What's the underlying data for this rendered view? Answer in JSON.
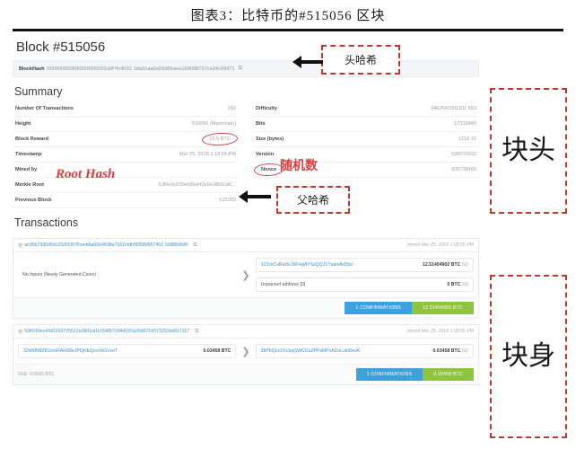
{
  "figure": {
    "title": "图表3：比特币的#515056 区块"
  },
  "explorer": {
    "block_title": "Block #515056",
    "hash_bar": {
      "label": "BlockHash",
      "value": "000000000000000000001a9f7fc4032 1da51aa0a55d65aea199008737ce24c99471",
      "copy_icon": "⧉"
    },
    "summary_heading": "Summary",
    "summary_left": [
      {
        "key": "Number Of Transactions",
        "value": "182",
        "circled": false
      },
      {
        "key": "Height",
        "value": "515056 (Mainchain)",
        "circled": false
      },
      {
        "key": "Block Reward",
        "value": "12.5 BTC",
        "circled": true
      },
      {
        "key": "Timestamp",
        "value": "Mar 25, 2018 1:18:55 PM",
        "circled": false
      },
      {
        "key": "Mined by",
        "value": "",
        "circled": false
      },
      {
        "key": "Merkle Root",
        "value": "9.80e9c530ed2bd43a5e38b6cd0...",
        "circled": false
      },
      {
        "key": "Previous Block",
        "value": "515055",
        "circled": false
      }
    ],
    "summary_right": [
      {
        "key": "Difficulty",
        "value": "3462542391191.563",
        "circled": false
      },
      {
        "key": "Bits",
        "value": "17315849",
        "circled": false
      },
      {
        "key": "Size (bytes)",
        "value": "1218 31",
        "circled": false
      },
      {
        "key": "Version",
        "value": "536070912",
        "circled": false
      },
      {
        "key": "Nonce",
        "value": "926728450",
        "circled": true
      }
    ],
    "transactions_heading": "Transactions",
    "transactions": [
      {
        "hash": "acd5b7336959c250f3367fceeb6a62e4538e7162cfdb5f3580657453 10d8696d0",
        "gear_icon": "⚙",
        "copy_icon": "⧉",
        "time": "mined Mar 25, 2018 1:18:55 PM",
        "inputs": [
          {
            "address": "No Inputs (Newly Generated Coins)",
            "amount": "",
            "unit": "",
            "boxed": false,
            "muted": true
          }
        ],
        "arrow_icon": "❯",
        "outputs": [
          {
            "address": "1C1mCsRuklx1KFegAYSzQQJV7samAd2pv",
            "amount": "12.51404902 BTC",
            "unit": "(U)",
            "boxed": true,
            "muted": false
          },
          {
            "address": "Unparsed address [0]",
            "amount": "0 BTC",
            "unit": "(U)",
            "boxed": true,
            "muted": true
          }
        ],
        "fee": "",
        "badge_confirmations": "1 CONFIRMATIONS",
        "badge_amount": "12.51404902 BTC"
      },
      {
        "hash": "53b019ec43d3193725512a3901a01c590671944197a25d6714373251bd817117",
        "gear_icon": "⚙",
        "copy_icon": "⧉",
        "time": "mined Mar 25, 2018 1:18:55 PM",
        "inputs": [
          {
            "address": "32H6BWZE1mxRAH38eJPQHbZycnYiGVveT",
            "amount": "0.03458 BTC",
            "unit": "",
            "boxed": true,
            "muted": false
          }
        ],
        "arrow_icon": "❯",
        "outputs": [
          {
            "address": "38PbQcsXXcbqQWCUuZPFkMPvADxLukiDevK",
            "amount": "0.03458 BTC",
            "unit": "(U)",
            "boxed": true,
            "muted": false
          }
        ],
        "fee": "FEE: 0.0005 BTC",
        "badge_confirmations": "1 CONFIRMATIONS",
        "badge_amount": "0.03458 BTC"
      }
    ]
  },
  "annotations": {
    "header_hash": "头哈希",
    "parent_hash": "父哈希",
    "block_head": "块头",
    "block_body": "块身",
    "root_hash_note": "Root Hash",
    "nonce_note": "随机数"
  },
  "colors": {
    "annotation_red": "#c0392b",
    "handwriting_red": "#e03a3a",
    "badge_blue": "#3ba2dd",
    "badge_green": "#8fc43f",
    "link_blue": "#3b8fd4"
  }
}
